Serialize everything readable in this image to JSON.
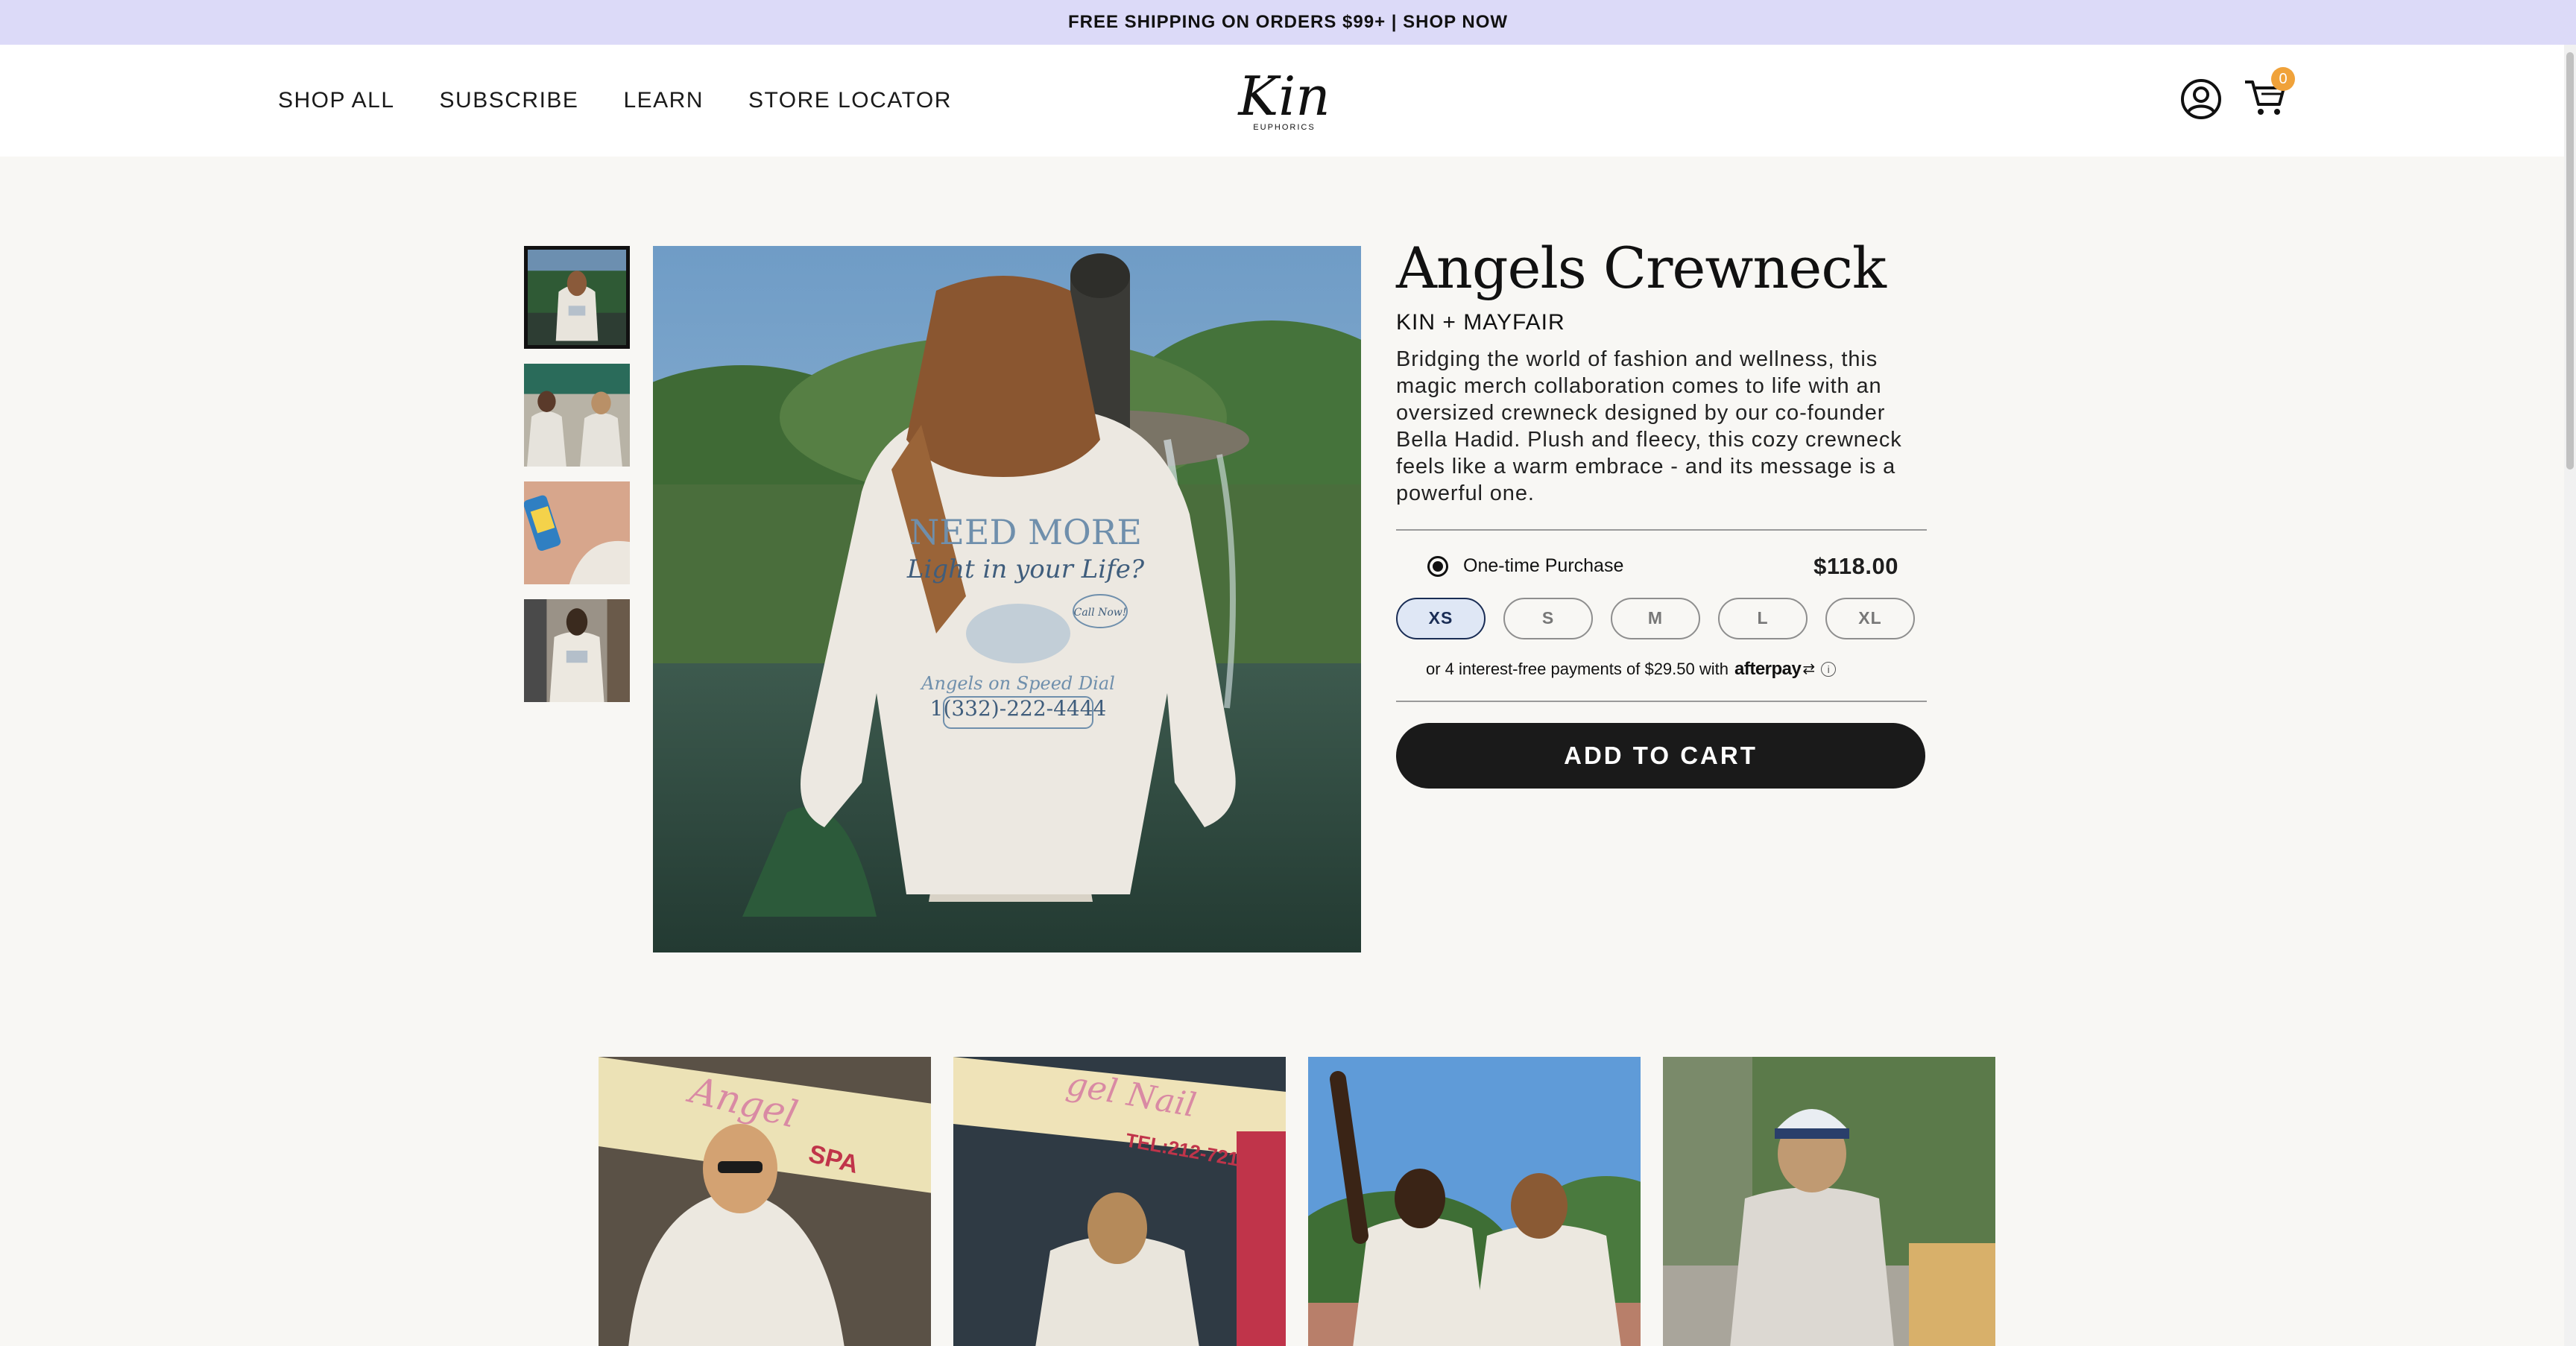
{
  "announcement": "FREE SHIPPING ON ORDERS $99+ | SHOP NOW",
  "nav": {
    "items": [
      "SHOP ALL",
      "SUBSCRIBE",
      "LEARN",
      "STORE LOCATOR"
    ]
  },
  "logo": {
    "text": "Kin",
    "subtext": "EUPHORICS"
  },
  "header": {
    "cart_count": "0"
  },
  "product": {
    "title": "Angels Crewneck",
    "brand": "KIN + MAYFAIR",
    "description": "Bridging the world of fashion and wellness, this magic merch collaboration comes to life with an oversized crewneck designed by our co-founder Bella Hadid. Plush and fleecy, this cozy crewneck feels like a warm embrace - and its message is a powerful one.",
    "purchase_option": "One-time Purchase",
    "price": "$118.00",
    "sizes": [
      "XS",
      "S",
      "M",
      "L",
      "XL"
    ],
    "selected_size": "XS",
    "afterpay_text": "or 4 interest-free payments of $29.50 with",
    "afterpay_brand": "afterpay",
    "add_to_cart": "ADD TO CART"
  },
  "main_image": {
    "print_line1": "NEED MORE",
    "print_line2": "Light in your Life?",
    "print_bubble": "Call Now!",
    "print_line3": "Angels on Speed Dial",
    "print_phone": "1(332)-222-4444"
  },
  "colors": {
    "announcement_bg": "#dcdaf8",
    "button_bg": "#1a1a1a",
    "cart_badge": "#f0a23a",
    "selected_size_bg": "#dfe7f5"
  }
}
